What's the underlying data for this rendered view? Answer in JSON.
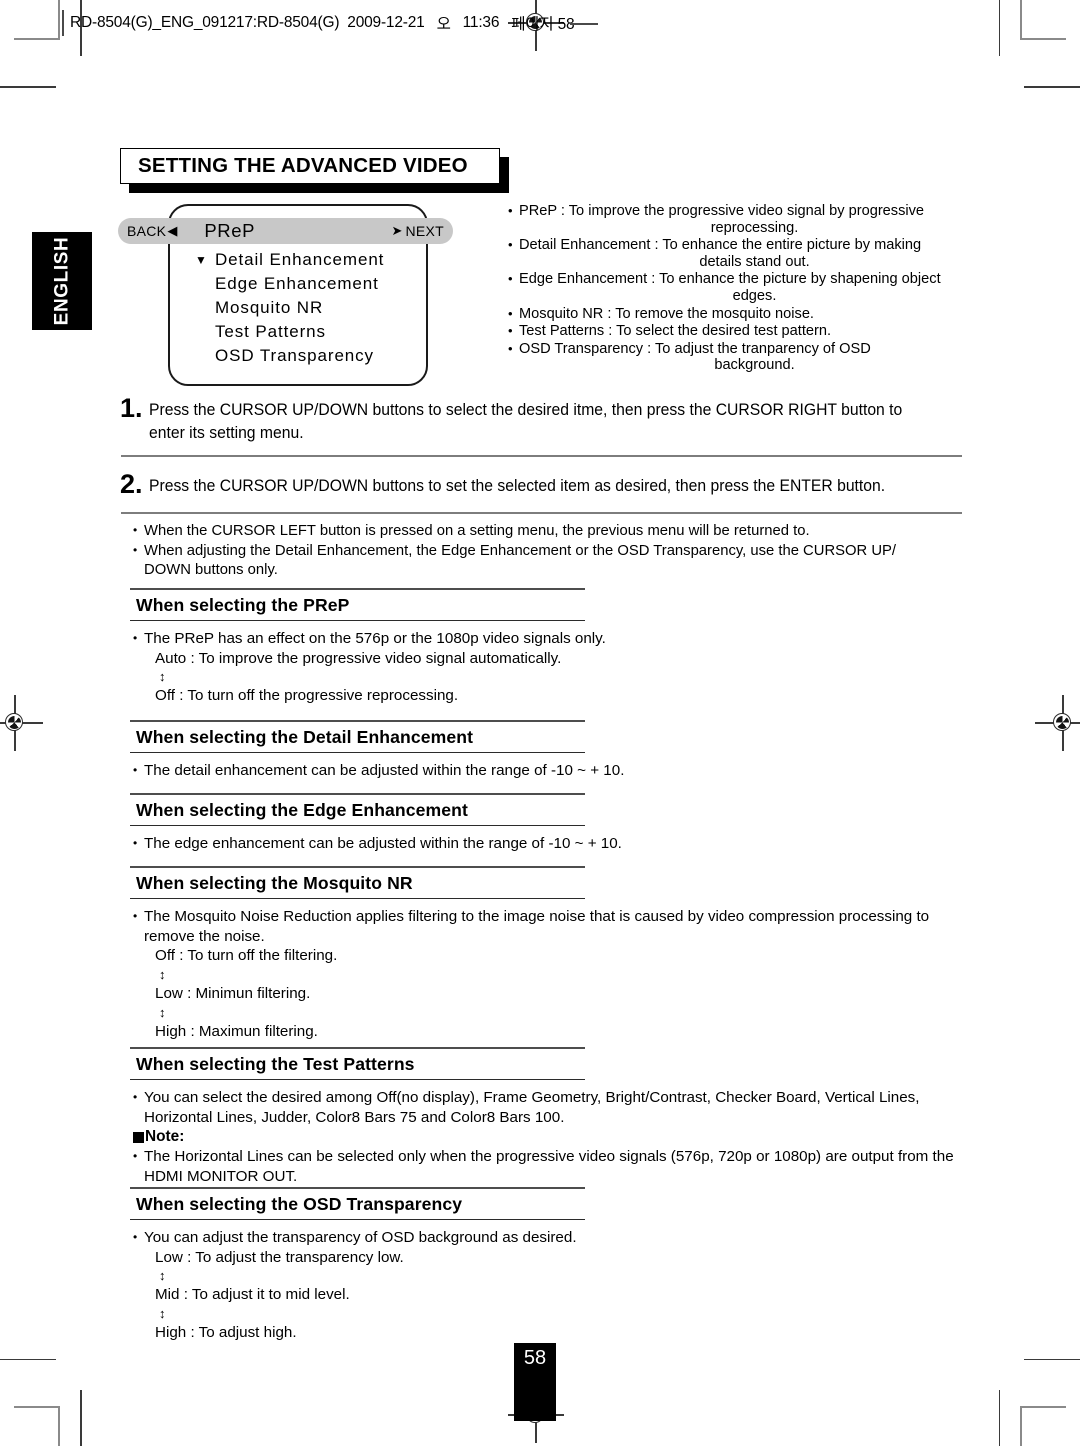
{
  "slug": {
    "file": "RD-8504(G)_ENG_091217:RD-8504(G)",
    "date": "2009-12-21",
    "meridiem": "오",
    "time": "11:36",
    "page_label": "페이지 58"
  },
  "side_tab": {
    "label": "ENGLISH"
  },
  "title": {
    "text": "SETTING THE ADVANCED VIDEO"
  },
  "osd": {
    "back_label": "BACK",
    "back_arrow": "◀",
    "next_label": "NEXT",
    "next_arrow": "➤",
    "selected_item": "PReP",
    "caret": "▼",
    "items": [
      {
        "label": "Detail Enhancement",
        "caret": true
      },
      {
        "label": "Edge Enhancement",
        "caret": false
      },
      {
        "label": "Mosquito NR",
        "caret": false
      },
      {
        "label": "Test Patterns",
        "caret": false
      },
      {
        "label": "OSD Transparency",
        "caret": false
      }
    ]
  },
  "osd_notes": [
    {
      "line1": "PReP : To improve the progressive video signal by progressive",
      "line2": "reprocessing."
    },
    {
      "line1": "Detail Enhancement : To enhance the entire picture by making",
      "line2": "details stand out."
    },
    {
      "line1": "Edge Enhancement : To enhance the picture by shapening object",
      "line2": "edges."
    },
    {
      "line1": "Mosquito NR : To remove the mosquito noise.",
      "line2": ""
    },
    {
      "line1": "Test Patterns : To select the desired test pattern.",
      "line2": ""
    },
    {
      "line1": "OSD Transparency : To adjust the tranparency of OSD",
      "line2": "background."
    }
  ],
  "steps": [
    {
      "num": "1.",
      "text": "Press the CURSOR UP/DOWN buttons to select the desired itme, then press the CURSOR RIGHT button to enter its setting menu."
    },
    {
      "num": "2.",
      "text": "Press the CURSOR UP/DOWN buttons to set the selected item as desired, then press the ENTER button."
    }
  ],
  "general_notes": [
    "When the CURSOR LEFT button is pressed on a setting menu, the previous menu will be returned to.",
    "When adjusting the Detail Enhancement, the Edge Enhancement or the OSD Transparency, use the CURSOR UP/ DOWN buttons only."
  ],
  "sections": {
    "prep": {
      "heading": "When selecting the PReP",
      "bullet": "The PReP has an effect on the 576p or the 1080p video signals only.",
      "opt1": "Auto : To improve the progressive video signal automatically.",
      "updown": "↕",
      "opt2": "Off : To turn off the progressive reprocessing."
    },
    "detail": {
      "heading": "When selecting the Detail Enhancement",
      "bullet": "The detail enhancement can be adjusted within the range of -10 ~ + 10."
    },
    "edge": {
      "heading": "When selecting the Edge Enhancement",
      "bullet": "The edge enhancement can be adjusted within the range of -10 ~ + 10."
    },
    "mosquito": {
      "heading": "When selecting the Mosquito NR",
      "bullet": "The Mosquito Noise Reduction applies filtering to the image noise that is caused by video compression processing to remove the noise.",
      "opt1": "Off : To turn off the filtering.",
      "updown1": "↕",
      "opt2": "Low : Minimun filtering.",
      "updown2": "↕",
      "opt3": "High : Maximun filtering."
    },
    "test": {
      "heading": "When selecting the Test Patterns",
      "bullet": "You can select the desired among Off(no display), Frame Geometry, Bright/Contrast, Checker Board, Vertical Lines, Horizontal Lines, Judder, Color8 Bars 75 and Color8 Bars 100.",
      "note_label": "Note:",
      "note_bullet": "The Horizontal Lines can be selected only when the progressive video signals (576p, 720p or 1080p) are output from the HDMI MONITOR OUT."
    },
    "osd_transparency": {
      "heading": "When selecting the OSD Transparency",
      "bullet": "You can adjust the transparency of OSD background as desired.",
      "opt1": "Low : To adjust the transparency low.",
      "updown1": "↕",
      "opt2": "Mid : To adjust it to mid level.",
      "updown2": "↕",
      "opt3": "High : To adjust high."
    }
  },
  "footer": {
    "page_number": "58"
  },
  "bullet_glyph": "•"
}
